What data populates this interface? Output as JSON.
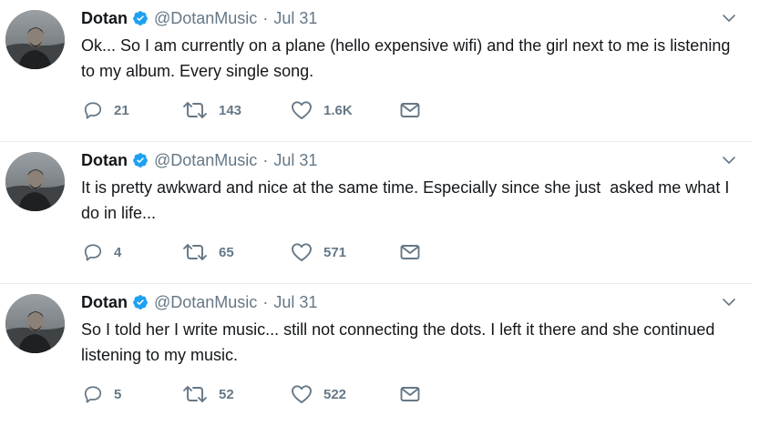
{
  "tweets": [
    {
      "name": "Dotan",
      "handle": "@DotanMusic",
      "separator": "·",
      "time": "Jul 31",
      "text": "Ok... So I am currently on a plane (hello expensive wifi) and the girl next to me is listening to my album. Every single song.",
      "replies": "21",
      "retweets": "143",
      "likes": "1.6K"
    },
    {
      "name": "Dotan",
      "handle": "@DotanMusic",
      "separator": "·",
      "time": "Jul 31",
      "text": "It is pretty awkward and nice at the same time. Especially since she just  asked me what I do in life...",
      "replies": "4",
      "retweets": "65",
      "likes": "571"
    },
    {
      "name": "Dotan",
      "handle": "@DotanMusic",
      "separator": "·",
      "time": "Jul 31",
      "text": "So I told her I write music... still not connecting the dots. I left it there and she continued listening to my music.",
      "replies": "5",
      "retweets": "52",
      "likes": "522"
    }
  ],
  "icons": {
    "verified": "verified-badge-icon",
    "caret": "chevron-down-icon",
    "reply": "reply-icon",
    "retweet": "retweet-icon",
    "like": "heart-icon",
    "dm": "envelope-icon"
  },
  "colors": {
    "text": "#14171a",
    "secondary": "#657786",
    "verified": "#1da1f2",
    "divider": "#e6ecf0"
  }
}
